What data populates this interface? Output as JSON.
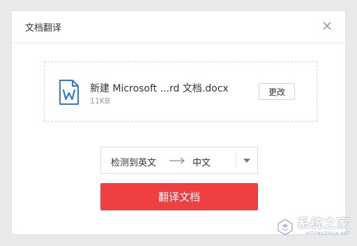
{
  "dialog": {
    "title": "文档翻译",
    "close_icon": "close-icon"
  },
  "file": {
    "icon": "word-document-icon",
    "icon_color": "#2b7cd3",
    "name": "新建 Microsoft ...rd 文档.docx",
    "size": "11KB",
    "change_label": "更改"
  },
  "language": {
    "source": "检测到英文",
    "arrow_icon": "arrow-right-icon",
    "target": "中文",
    "dropdown_icon": "caret-down-icon"
  },
  "action": {
    "translate_label": "翻译文档",
    "color": "#ee3f43"
  },
  "watermark": {
    "text": "系统之家",
    "url": "XITONGZHIJIA.NET"
  }
}
